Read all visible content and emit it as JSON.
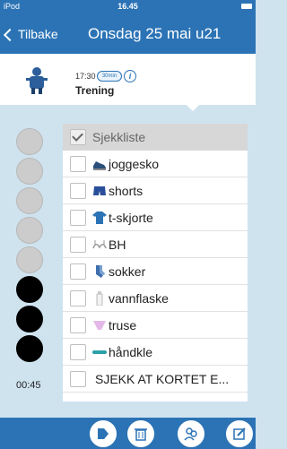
{
  "status": {
    "carrier": "iPod",
    "time": "16.45"
  },
  "nav": {
    "back_label": "Tilbake",
    "title": "Onsdag 25 mai u21"
  },
  "event": {
    "time": "17:30",
    "duration": "30min",
    "info": "i",
    "title": "Trening"
  },
  "timer": "00:45",
  "circles": [
    "gray",
    "gray",
    "gray",
    "gray",
    "gray",
    "black",
    "black",
    "black"
  ],
  "checklist": {
    "header": "Sjekkliste",
    "items": [
      {
        "label": "joggesko",
        "icon": "shoe-icon"
      },
      {
        "label": "shorts",
        "icon": "shorts-icon"
      },
      {
        "label": "t-skjorte",
        "icon": "tshirt-icon"
      },
      {
        "label": "BH",
        "icon": "bra-icon"
      },
      {
        "label": "sokker",
        "icon": "socks-icon"
      },
      {
        "label": "vannflaske",
        "icon": "bottle-icon"
      },
      {
        "label": "truse",
        "icon": "underwear-icon"
      },
      {
        "label": "håndkle",
        "icon": "towel-icon"
      },
      {
        "label": "SJEKK AT KORTET E..."
      }
    ]
  },
  "footer_icons": [
    "puzzle-icon",
    "trash-icon",
    "people-icon",
    "edit-icon"
  ],
  "colors": {
    "accent": "#2b73b5",
    "background": "#cfe3ef",
    "circle_gray": "#cccccc",
    "circle_black": "#000000"
  }
}
